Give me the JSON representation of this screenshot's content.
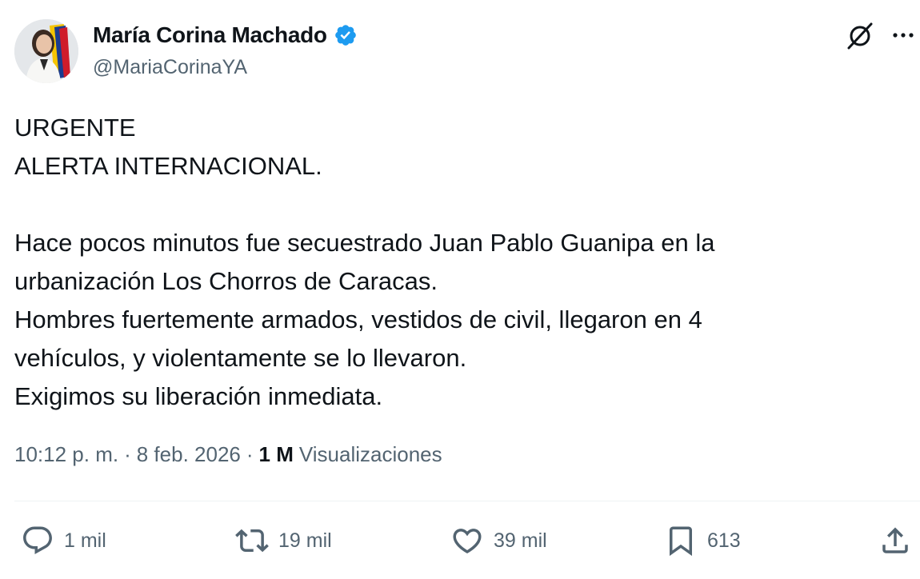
{
  "author": {
    "display_name": "María Corina Machado",
    "handle": "@MariaCorinaYA",
    "verified": true,
    "verified_color": "#1d9bf0"
  },
  "tweet": {
    "text": "URGENTE\nALERTA INTERNACIONAL.\n\nHace pocos minutos fue secuestrado Juan Pablo Guanipa en la\nurbanización Los Chorros de Caracas.\nHombres fuertemente armados, vestidos de civil, llegaron en 4\nvehículos, y violentamente se lo llevaron.\nExigimos su liberación inmediata.",
    "time": "10:12 p. m.",
    "date": "8 feb. 2026",
    "separator": "·",
    "views_count": "1 M",
    "views_label": "Visualizaciones"
  },
  "actions": {
    "replies": "1 mil",
    "reposts": "19 mil",
    "likes": "39 mil",
    "bookmarks": "613"
  },
  "icons": [
    "verified-badge-icon",
    "grok-icon",
    "more-icon",
    "reply-icon",
    "repost-icon",
    "like-icon",
    "bookmark-icon",
    "share-icon"
  ],
  "colors": {
    "text": "#0f1419",
    "secondary": "#536471",
    "accent": "#1d9bf0"
  }
}
